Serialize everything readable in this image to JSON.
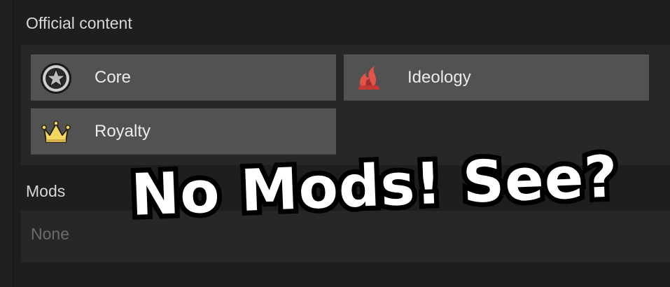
{
  "official": {
    "title": "Official content",
    "items": [
      {
        "label": "Core",
        "icon": "core-star-icon"
      },
      {
        "label": "Ideology",
        "icon": "ideology-flame-icon"
      },
      {
        "label": "Royalty",
        "icon": "royalty-crown-icon"
      }
    ]
  },
  "mods": {
    "title": "Mods",
    "empty_text": "None"
  },
  "overlay": {
    "caption": "No Mods! See?"
  },
  "colors": {
    "background": "#1f2021",
    "tile": "#525252",
    "ideology_red": "#d9493f",
    "royalty_gold": "#f2d860"
  }
}
